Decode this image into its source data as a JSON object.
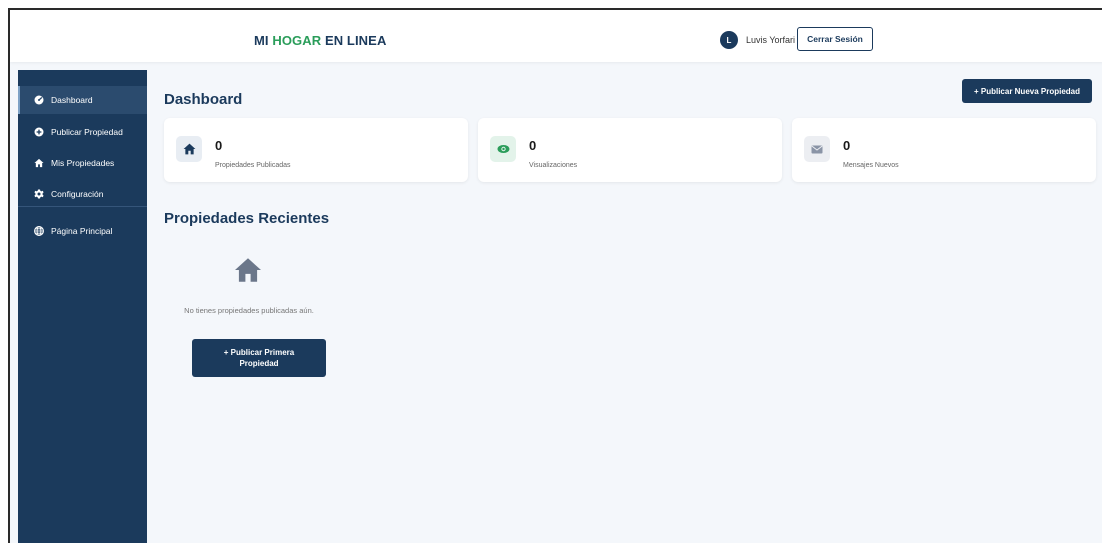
{
  "header": {
    "brand_part1": "MI ",
    "brand_accent": "HOGAR",
    "brand_part2": " EN LINEA",
    "avatar_initial": "L",
    "username": "Luvis Yorfari",
    "logout_label": "Cerrar Sesión"
  },
  "sidebar": {
    "items": [
      {
        "label": "Dashboard",
        "icon": "dashboard-icon",
        "active": true
      },
      {
        "label": "Publicar Propiedad",
        "icon": "plus-circle-icon"
      },
      {
        "label": "Mis Propiedades",
        "icon": "home-icon"
      },
      {
        "label": "Configuración",
        "icon": "gear-icon"
      },
      {
        "label": "Página Principal",
        "icon": "globe-icon"
      }
    ]
  },
  "main": {
    "title": "Dashboard",
    "publish_new_label": "+ Publicar Nueva Propiedad",
    "stats": [
      {
        "value": "0",
        "label": "Propiedades Publicadas",
        "icon": "home-icon"
      },
      {
        "value": "0",
        "label": "Visualizaciones",
        "icon": "eye-icon"
      },
      {
        "value": "0",
        "label": "Mensajes Nuevos",
        "icon": "envelope-icon"
      }
    ],
    "recent_title": "Propiedades Recientes",
    "empty_text": "No tienes propiedades publicadas aún.",
    "publish_first_label": "+ Publicar Primera Propiedad"
  },
  "colors": {
    "primary": "#1b3a5c",
    "accent_green": "#2a9d5a",
    "background": "#f4f7fb"
  }
}
